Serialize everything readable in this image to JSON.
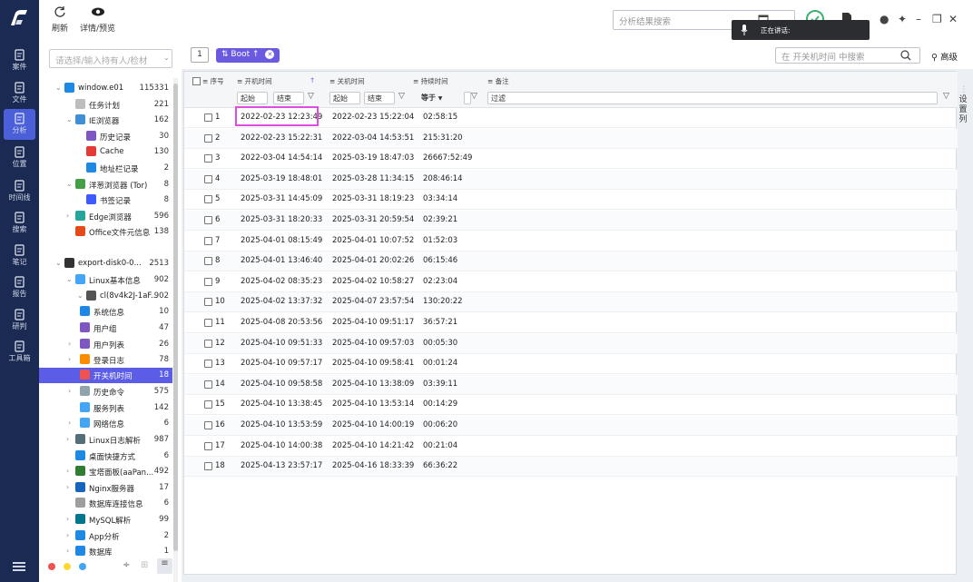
{
  "nav": {
    "items": [
      {
        "label": "案件",
        "icon": "case-icon"
      },
      {
        "label": "文件",
        "icon": "folder-icon"
      },
      {
        "label": "分析",
        "icon": "analysis-icon",
        "active": true
      },
      {
        "label": "位置",
        "icon": "location-icon"
      },
      {
        "label": "时间线",
        "icon": "timeline-icon"
      },
      {
        "label": "搜索",
        "icon": "search-icon"
      },
      {
        "label": "笔记",
        "icon": "note-icon"
      },
      {
        "label": "报告",
        "icon": "report-icon"
      },
      {
        "label": "研判",
        "icon": "judge-icon"
      },
      {
        "label": "工具箱",
        "icon": "toolbox-icon"
      }
    ]
  },
  "toolbar": {
    "refresh_label": "刷新",
    "detail_label": "详情/预览",
    "search_placeholder": "分析结果搜索",
    "speaking_text": "正在讲话:"
  },
  "tree": {
    "search_placeholder": "请选择/输入持有人/检材",
    "items": [
      {
        "label": "window.e01",
        "count": "115331",
        "indent": 1,
        "chev": "v",
        "icon": "windows-icon",
        "color": "#1e88e5"
      },
      {
        "label": "任务计划",
        "count": "221",
        "indent": 2,
        "chev": "",
        "icon": "task-icon",
        "color": "#bdbdbd"
      },
      {
        "label": "IE浏览器",
        "count": "162",
        "indent": 2,
        "chev": "v",
        "icon": "ie-icon",
        "color": "#3f8fd6"
      },
      {
        "label": "历史记录",
        "count": "30",
        "indent": 3,
        "chev": "",
        "icon": "history-icon",
        "color": "#7e57c2"
      },
      {
        "label": "Cache",
        "count": "130",
        "indent": 3,
        "chev": "",
        "icon": "cache-icon",
        "color": "#e53935"
      },
      {
        "label": "地址栏记录",
        "count": "2",
        "indent": 3,
        "chev": "",
        "icon": "address-icon",
        "color": "#1e88e5"
      },
      {
        "label": "洋葱浏览器 (Tor)",
        "count": "8",
        "indent": 2,
        "chev": "v",
        "icon": "tor-icon",
        "color": "#43a047"
      },
      {
        "label": "书签记录",
        "count": "8",
        "indent": 3,
        "chev": "",
        "icon": "bookmark-icon",
        "color": "#3d5afe"
      },
      {
        "label": "Edge浏览器",
        "count": "596",
        "indent": 2,
        "chev": ">",
        "icon": "edge-icon",
        "color": "#26a69a"
      },
      {
        "label": "Office文件元信息",
        "count": "138",
        "indent": 2,
        "chev": "",
        "icon": "office-icon",
        "color": "#e64a19"
      },
      {
        "label": "export-disk0-0...",
        "count": "2513",
        "indent": 1,
        "chev": "v",
        "icon": "linux-icon",
        "color": "#333333"
      },
      {
        "label": "Linux基本信息",
        "count": "902",
        "indent": 2,
        "chev": "v",
        "icon": "doc-icon",
        "color": "#42a5f5"
      },
      {
        "label": "cl(8v4k2J-1aF...",
        "count": "902",
        "indent": 3,
        "chev": "v",
        "icon": "disk-icon",
        "color": "#555555"
      },
      {
        "label": "系统信息",
        "count": "10",
        "indent": 4,
        "chev": "",
        "icon": "sysinfo-icon",
        "color": "#1e88e5"
      },
      {
        "label": "用户组",
        "count": "47",
        "indent": 4,
        "chev": "",
        "icon": "usergroup-icon",
        "color": "#7e57c2"
      },
      {
        "label": "用户列表",
        "count": "26",
        "indent": 4,
        "chev": ">",
        "icon": "userlist-icon",
        "color": "#7e57c2"
      },
      {
        "label": "登录日志",
        "count": "78",
        "indent": 4,
        "chev": ">",
        "icon": "login-log-icon",
        "color": "#fb8c00"
      },
      {
        "label": "开关机时间",
        "count": "18",
        "indent": 4,
        "chev": "",
        "icon": "power-icon",
        "color": "#ef5350",
        "selected": true
      },
      {
        "label": "历史命令",
        "count": "575",
        "indent": 4,
        "chev": ">",
        "icon": "cmd-history-icon",
        "color": "#90a4ae"
      },
      {
        "label": "服务列表",
        "count": "142",
        "indent": 4,
        "chev": "",
        "icon": "service-icon",
        "color": "#42a5f5"
      },
      {
        "label": "网络信息",
        "count": "6",
        "indent": 4,
        "chev": ">",
        "icon": "network-icon",
        "color": "#42a5f5"
      },
      {
        "label": "Linux日志解析",
        "count": "987",
        "indent": 2,
        "chev": ">",
        "icon": "log-icon",
        "color": "#546e7a"
      },
      {
        "label": "桌面快捷方式",
        "count": "6",
        "indent": 2,
        "chev": "",
        "icon": "shortcut-icon",
        "color": "#1e88e5"
      },
      {
        "label": "宝塔面板(aaPan...",
        "count": "492",
        "indent": 2,
        "chev": ">",
        "icon": "bt-icon",
        "color": "#2e7d32"
      },
      {
        "label": "Nginx服务器",
        "count": "17",
        "indent": 2,
        "chev": ">",
        "icon": "nginx-icon",
        "color": "#1565c0"
      },
      {
        "label": "数据库连接信息",
        "count": "6",
        "indent": 2,
        "chev": "",
        "icon": "db-conn-icon",
        "color": "#9e9e9e"
      },
      {
        "label": "MySQL解析",
        "count": "99",
        "indent": 2,
        "chev": ">",
        "icon": "mysql-icon",
        "color": "#00758f"
      },
      {
        "label": "App分析",
        "count": "2",
        "indent": 2,
        "chev": ">",
        "icon": "app-icon",
        "color": "#1e88e5"
      },
      {
        "label": "数据库",
        "count": "1",
        "indent": 2,
        "chev": ">",
        "icon": "database-icon",
        "color": "#1e88e5"
      }
    ]
  },
  "main": {
    "tag_number": "1",
    "boot_tag": "Boot ↑",
    "table_search_placeholder": "在 开关机时间 中搜索",
    "advanced_label": "高级",
    "col_settings": "设置列",
    "headers": {
      "seq": "序号",
      "boot": "开机时间",
      "shutdown": "关机时间",
      "duration": "持续时间",
      "note": "备注"
    },
    "filters": {
      "start": "起始",
      "end": "结束",
      "eq": "等于",
      "filter": "过滤"
    },
    "rows": [
      {
        "n": "1",
        "boot": "2022-02-23 12:23:49",
        "shutdown": "2022-02-23 15:22:04",
        "duration": "02:58:15"
      },
      {
        "n": "2",
        "boot": "2022-02-23 15:22:31",
        "shutdown": "2022-03-04 14:53:51",
        "duration": "215:31:20"
      },
      {
        "n": "3",
        "boot": "2022-03-04 14:54:14",
        "shutdown": "2025-03-19 18:47:03",
        "duration": "26667:52:49"
      },
      {
        "n": "4",
        "boot": "2025-03-19 18:48:01",
        "shutdown": "2025-03-28 11:34:15",
        "duration": "208:46:14"
      },
      {
        "n": "5",
        "boot": "2025-03-31 14:45:09",
        "shutdown": "2025-03-31 18:19:23",
        "duration": "03:34:14"
      },
      {
        "n": "6",
        "boot": "2025-03-31 18:20:33",
        "shutdown": "2025-03-31 20:59:54",
        "duration": "02:39:21"
      },
      {
        "n": "7",
        "boot": "2025-04-01 08:15:49",
        "shutdown": "2025-04-01 10:07:52",
        "duration": "01:52:03"
      },
      {
        "n": "8",
        "boot": "2025-04-01 13:46:40",
        "shutdown": "2025-04-01 20:02:26",
        "duration": "06:15:46"
      },
      {
        "n": "9",
        "boot": "2025-04-02 08:35:23",
        "shutdown": "2025-04-02 10:58:27",
        "duration": "02:23:04"
      },
      {
        "n": "10",
        "boot": "2025-04-02 13:37:32",
        "shutdown": "2025-04-07 23:57:54",
        "duration": "130:20:22"
      },
      {
        "n": "11",
        "boot": "2025-04-08 20:53:56",
        "shutdown": "2025-04-10 09:51:17",
        "duration": "36:57:21"
      },
      {
        "n": "12",
        "boot": "2025-04-10 09:51:33",
        "shutdown": "2025-04-10 09:57:03",
        "duration": "00:05:30"
      },
      {
        "n": "13",
        "boot": "2025-04-10 09:57:17",
        "shutdown": "2025-04-10 09:58:41",
        "duration": "00:01:24"
      },
      {
        "n": "14",
        "boot": "2025-04-10 09:58:58",
        "shutdown": "2025-04-10 13:38:09",
        "duration": "03:39:11"
      },
      {
        "n": "15",
        "boot": "2025-04-10 13:38:45",
        "shutdown": "2025-04-10 13:53:14",
        "duration": "00:14:29"
      },
      {
        "n": "16",
        "boot": "2025-04-10 13:53:59",
        "shutdown": "2025-04-10 14:00:19",
        "duration": "00:06:20"
      },
      {
        "n": "17",
        "boot": "2025-04-10 14:00:38",
        "shutdown": "2025-04-10 14:21:42",
        "duration": "00:21:04"
      },
      {
        "n": "18",
        "boot": "2025-04-13 23:57:17",
        "shutdown": "2025-04-16 18:33:39",
        "duration": "66:36:22"
      }
    ]
  }
}
